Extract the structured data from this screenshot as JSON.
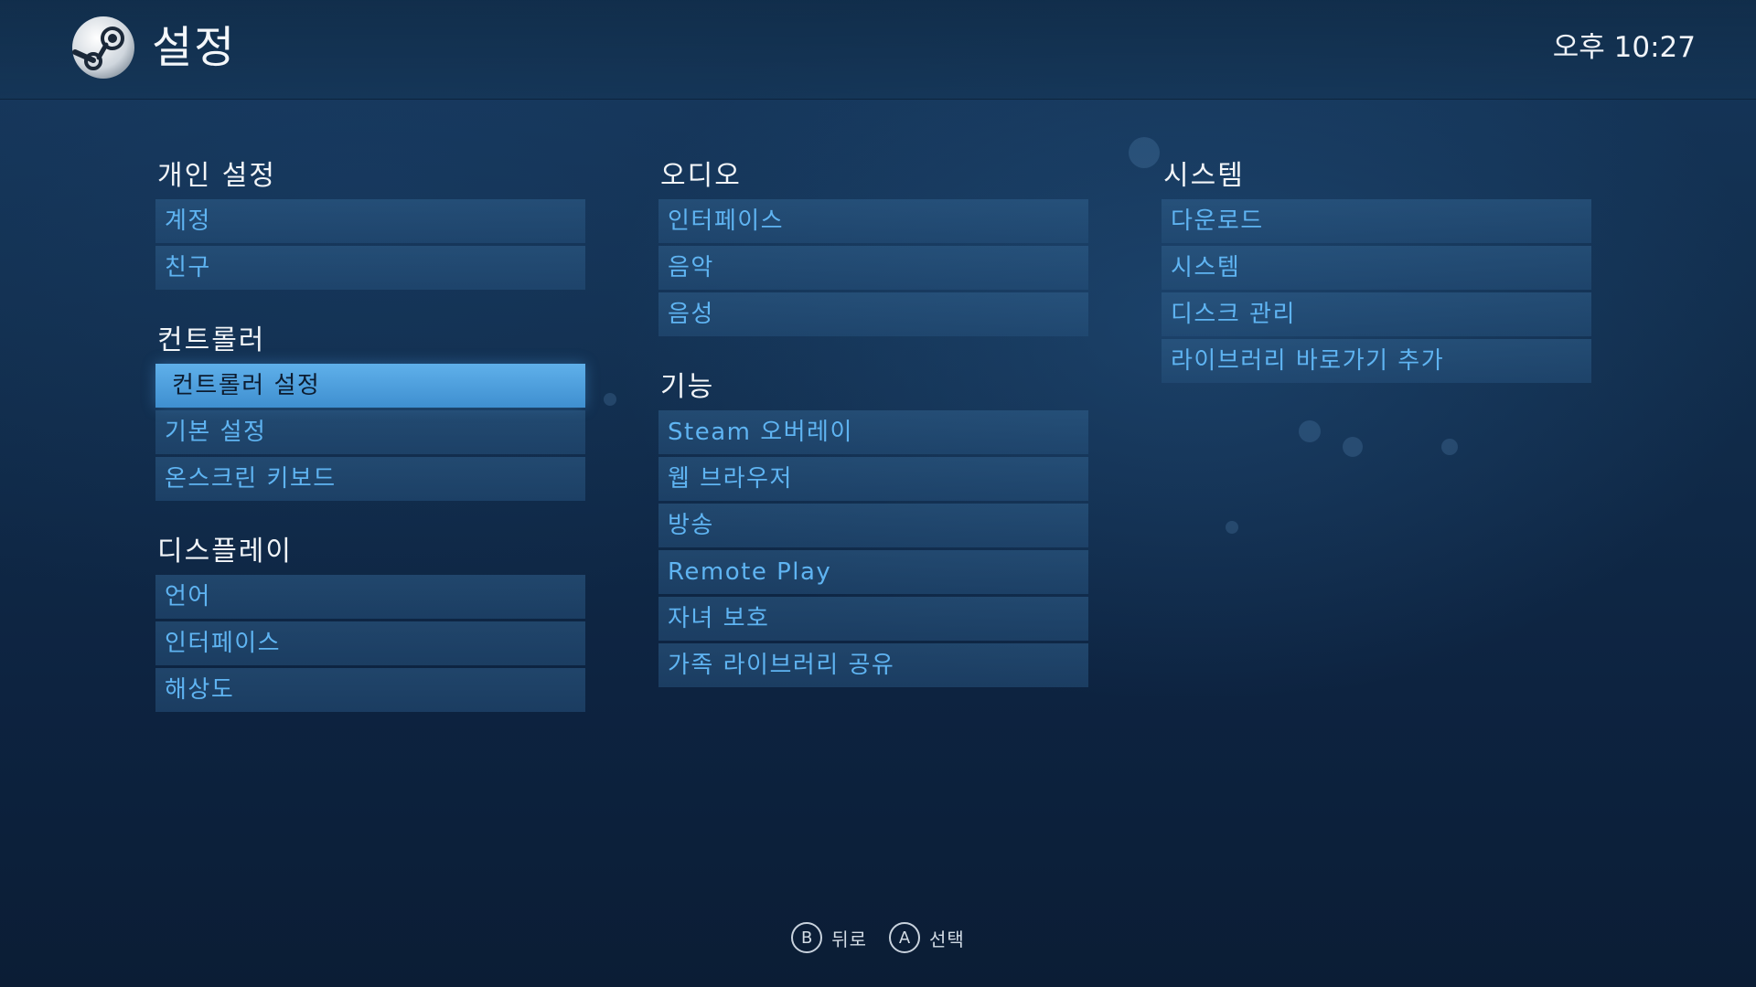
{
  "header": {
    "title": "설정",
    "clock": "오후 10:27",
    "logo_icon": "steam-logo-icon"
  },
  "columns": [
    {
      "groups": [
        {
          "title": "개인 설정",
          "items": [
            "계정",
            "친구"
          ]
        },
        {
          "title": "컨트롤러",
          "items": [
            "컨트롤러 설정",
            "기본 설정",
            "온스크린 키보드"
          ]
        },
        {
          "title": "디스플레이",
          "items": [
            "언어",
            "인터페이스",
            "해상도"
          ]
        }
      ]
    },
    {
      "groups": [
        {
          "title": "오디오",
          "items": [
            "인터페이스",
            "음악",
            "음성"
          ]
        },
        {
          "title": "기능",
          "items": [
            "Steam 오버레이",
            "웹 브라우저",
            "방송",
            "Remote Play",
            "자녀 보호",
            "가족 라이브러리 공유"
          ]
        }
      ]
    },
    {
      "groups": [
        {
          "title": "시스템",
          "items": [
            "다운로드",
            "시스템",
            "디스크 관리",
            "라이브러리 바로가기 추가"
          ]
        }
      ]
    }
  ],
  "selected_item": "컨트롤러 설정",
  "footer": {
    "hints": [
      {
        "button": "B",
        "label": "뒤로"
      },
      {
        "button": "A",
        "label": "선택"
      }
    ]
  },
  "colors": {
    "item_text": "#5fb4f2",
    "selected_bg": "#5fb0ea",
    "selected_text": "#0c1c30"
  }
}
